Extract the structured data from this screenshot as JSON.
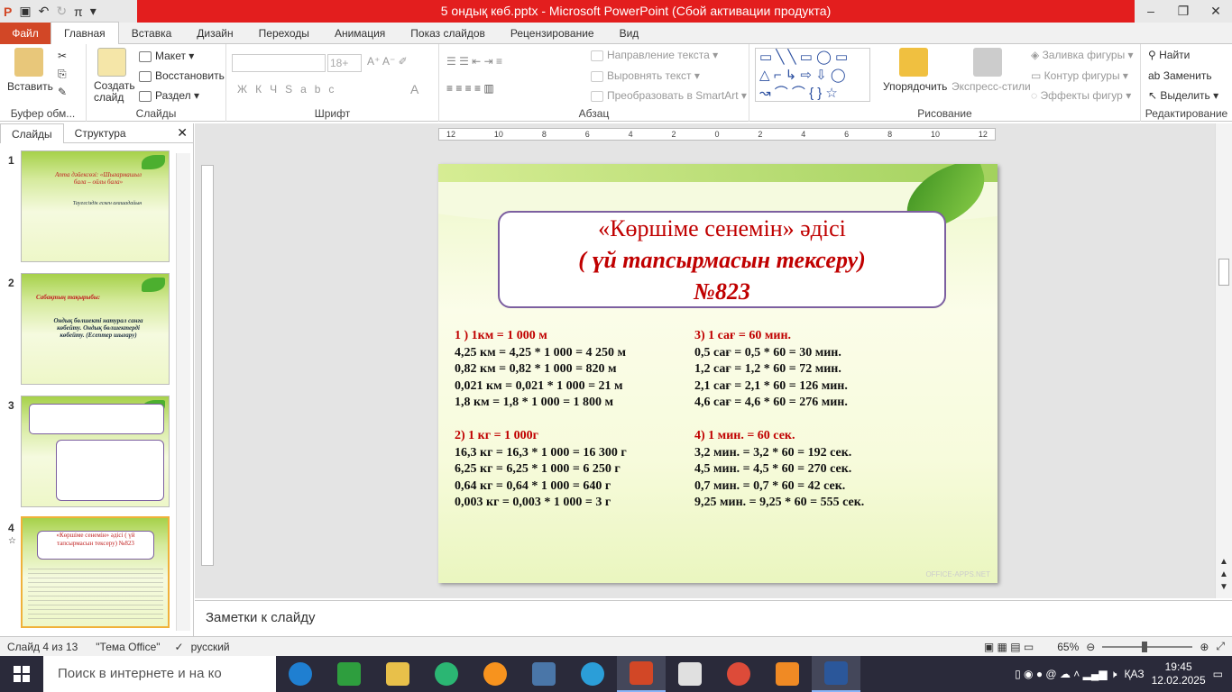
{
  "window": {
    "title": "5 ондық көб.pptx  -  Microsoft PowerPoint (Сбой активации продукта)"
  },
  "qat": {
    "save": "Save",
    "undo": "Undo",
    "redo": "Redo",
    "pi": "π"
  },
  "tabs": [
    "Файл",
    "Главная",
    "Вставка",
    "Дизайн",
    "Переходы",
    "Анимация",
    "Показ слайдов",
    "Рецензирование",
    "Вид"
  ],
  "ribbon": {
    "paste": "Вставить",
    "clipboard_group": "Буфер обм...",
    "new_slide": "Создать слайд",
    "layout": "Макет",
    "reset": "Восстановить",
    "section": "Раздел",
    "slides_group": "Слайды",
    "font_size": "18+",
    "font_group": "Шрифт",
    "paragraph_group": "Абзац",
    "text_direction": "Направление текста",
    "align_text": "Выровнять текст",
    "smartart": "Преобразовать в SmartArt",
    "arrange": "Упорядочить",
    "quick_styles": "Экспресс-стили",
    "shape_fill": "Заливка фигуры",
    "shape_outline": "Контур фигуры",
    "shape_effects": "Эффекты фигур",
    "drawing_group": "Рисование",
    "find": "Найти",
    "replace": "Заменить",
    "select": "Выделить",
    "editing_group": "Редактирование"
  },
  "panel": {
    "tab_slides": "Слайды",
    "tab_outline": "Структура",
    "thumbs": [
      {
        "num": "1",
        "title": "Апта дәйексөзі: «Шығармашыл бала – ойлы бала»",
        "sub": "Тауелсіздік ескен ағашадайын"
      },
      {
        "num": "2",
        "title": "Сабақтың тақырыбы:",
        "sub": "Ондық бөлшекті натурал санға көбейту. Ондық бөлшектерді көбейту. (Есептер шығару)"
      },
      {
        "num": "3",
        "title": "",
        "sub": ""
      },
      {
        "num": "4",
        "title": "«Көршіме сенемін» әдісі ( үй тапсырмасын тексеру) №823",
        "sub": ""
      }
    ]
  },
  "ruler": {
    "h": [
      "12",
      "10",
      "8",
      "6",
      "4",
      "2",
      "0",
      "2",
      "4",
      "6",
      "8",
      "10",
      "12"
    ]
  },
  "slide": {
    "title_line1": "«Көршіме сенемін» әдісі",
    "title_line2": "( үй тапсырмасын тексеру)",
    "title_line3": "№823",
    "left": {
      "h1": "1 ) 1км = 1 000 м",
      "l1": [
        "4,25 км = 4,25 * 1 000 = 4 250 м",
        "0,82 км = 0,82 * 1 000 = 820 м",
        "0,021 км = 0,021 * 1 000 = 21 м",
        "1,8 км = 1,8 * 1 000 = 1 800 м"
      ],
      "h2": "2) 1 кг = 1 000г",
      "l2": [
        "16,3 кг = 16,3 * 1 000 = 16 300 г",
        "6,25 кг = 6,25 * 1 000 = 6 250 г",
        "0,64 кг = 0,64 * 1 000 = 640 г",
        "0,003 кг = 0,003 * 1 000 = 3 г"
      ]
    },
    "right": {
      "h1": "3) 1 сағ = 60 мин.",
      "l1": [
        "0,5 сағ = 0,5 * 60 = 30 мин.",
        "1,2 сағ = 1,2 * 60 = 72 мин.",
        "2,1 сағ = 2,1 * 60 = 126 мин.",
        "4,6 сағ = 4,6 * 60 = 276 мин."
      ],
      "h2": "4) 1 мин. = 60 сек.",
      "l2": [
        "3,2 мин. = 3,2 * 60 = 192 сек.",
        "4,5 мин. = 4,5 * 60 = 270 сек.",
        "0,7 мин. = 0,7 * 60 = 42 сек.",
        "9,25 мин. = 9,25 * 60 = 555 сек."
      ]
    },
    "watermark": "OFFICE-APPS.NET"
  },
  "notes": {
    "placeholder": "Заметки к слайду"
  },
  "status": {
    "slide": "Слайд 4 из 13",
    "theme": "\"Тема Office\"",
    "lang": "русский",
    "zoom": "65%"
  },
  "taskbar": {
    "search": "Поиск в интернете и на ко",
    "lang": "ҚАЗ",
    "time": "19:45",
    "date": "12.02.2025"
  }
}
